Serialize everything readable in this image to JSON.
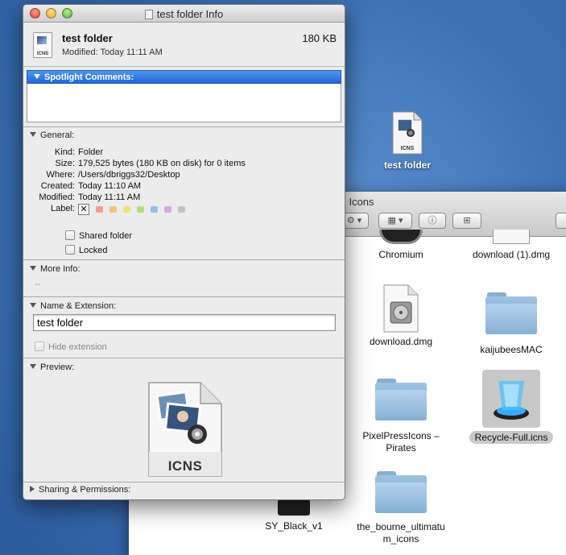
{
  "desktop": {
    "icon_label": "test folder",
    "icon_badge": "ICNS"
  },
  "finder": {
    "title": "Icons",
    "items": [
      {
        "label": "Chromium"
      },
      {
        "label": "download (1).dmg"
      },
      {
        "label": "download.dmg"
      },
      {
        "label": "kaijubeesMAC"
      },
      {
        "label": "PixelPressIcons – Pirates"
      },
      {
        "label": "Recycle-Full.icns"
      },
      {
        "label": "SY_Black_v1"
      },
      {
        "label": "the_bourne_ultimatum_icons"
      }
    ],
    "selected_item": "Recycle-Full.icns"
  },
  "info": {
    "title": "test folder Info",
    "name": "test folder",
    "size": "180 KB",
    "modified_line": "Modified: Today 11:11 AM",
    "icon_badge": "ICNS",
    "spotlight": {
      "label": "Spotlight Comments:",
      "value": ""
    },
    "general": {
      "label": "General:",
      "rows": [
        {
          "key": "Kind:",
          "value": "Folder"
        },
        {
          "key": "Size:",
          "value": "179,525 bytes (180 KB on disk) for 0 items"
        },
        {
          "key": "Where:",
          "value": "/Users/dbriggs32/Desktop"
        },
        {
          "key": "Created:",
          "value": "Today 11:10 AM"
        },
        {
          "key": "Modified:",
          "value": "Today 11:11 AM"
        }
      ],
      "label_key": "Label:",
      "label_none_glyph": "✕",
      "label_colors": [
        "#f59a94",
        "#f7c27a",
        "#f2e27a",
        "#b6dd7e",
        "#8fc0f3",
        "#d7a6e3",
        "#c4c4c4"
      ],
      "shared_folder": {
        "label": "Shared folder",
        "checked": false
      },
      "locked": {
        "label": "Locked",
        "checked": false
      }
    },
    "more_info": {
      "label": "More Info:",
      "value": "--"
    },
    "name_ext": {
      "label": "Name & Extension:",
      "value": "test folder",
      "hide_extension": {
        "label": "Hide extension",
        "checked": false,
        "disabled": true
      }
    },
    "preview": {
      "label": "Preview:",
      "badge": "ICNS"
    },
    "sharing": {
      "label": "Sharing & Permissions:"
    }
  }
}
